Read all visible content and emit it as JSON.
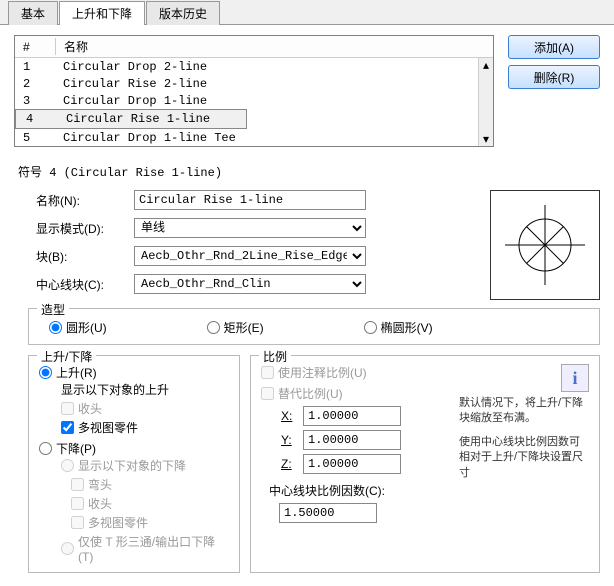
{
  "tabs": {
    "basic": "基本",
    "rise_drop": "上升和下降",
    "history": "版本历史"
  },
  "table": {
    "headers": {
      "num": "#",
      "name": "名称"
    },
    "rows": [
      {
        "num": "1",
        "name": "Circular Drop 2-line"
      },
      {
        "num": "2",
        "name": "Circular Rise 2-line"
      },
      {
        "num": "3",
        "name": "Circular Drop 1-line"
      },
      {
        "num": "4",
        "name": "Circular Rise 1-line"
      },
      {
        "num": "5",
        "name": "Circular Drop 1-line Tee"
      }
    ],
    "selected_index": 3
  },
  "buttons": {
    "add": "添加(A)",
    "remove": "删除(R)"
  },
  "section_title": "符号 4 (Circular Rise 1-line)",
  "form": {
    "name_label": "名称(N):",
    "name_value": "Circular Rise 1-line",
    "display_mode_label": "显示模式(D):",
    "display_mode_value": "单线",
    "block_label": "块(B):",
    "block_value": "Aecb_Othr_Rnd_2Line_Rise_Edge",
    "center_block_label": "中心线块(C):",
    "center_block_value": "Aecb_Othr_Rnd_Clin"
  },
  "shape": {
    "legend": "造型",
    "circle": "圆形(U)",
    "rect": "矩形(E)",
    "oval": "椭圆形(V)"
  },
  "rise_drop": {
    "legend": "上升/下降",
    "rise": "上升(R)",
    "rise_show": "显示以下对象的上升",
    "soffit": "收头",
    "mv_part": "多视图零件",
    "drop": "下降(P)",
    "drop_show": "显示以下对象的下降",
    "bend": "弯头",
    "tee_only": "仅使 T 形三通/输出口下降(T)"
  },
  "scale": {
    "legend": "比例",
    "anno": "使用注释比例(U)",
    "override": "替代比例(U)",
    "x_label": "X:",
    "x_val": "1.00000",
    "y_label": "Y:",
    "y_val": "1.00000",
    "z_label": "Z:",
    "z_val": "1.00000",
    "center_factor_label": "中心线块比例因数(C):",
    "center_factor_val": "1.50000",
    "info1": "默认情况下，将上升/下降块缩放至布满。",
    "info2": "使用中心线块比例因数可相对于上升/下降块设置尺寸"
  },
  "chart_data": {
    "type": "diagram",
    "description": "circle with cross and X (8 radial spokes)"
  }
}
